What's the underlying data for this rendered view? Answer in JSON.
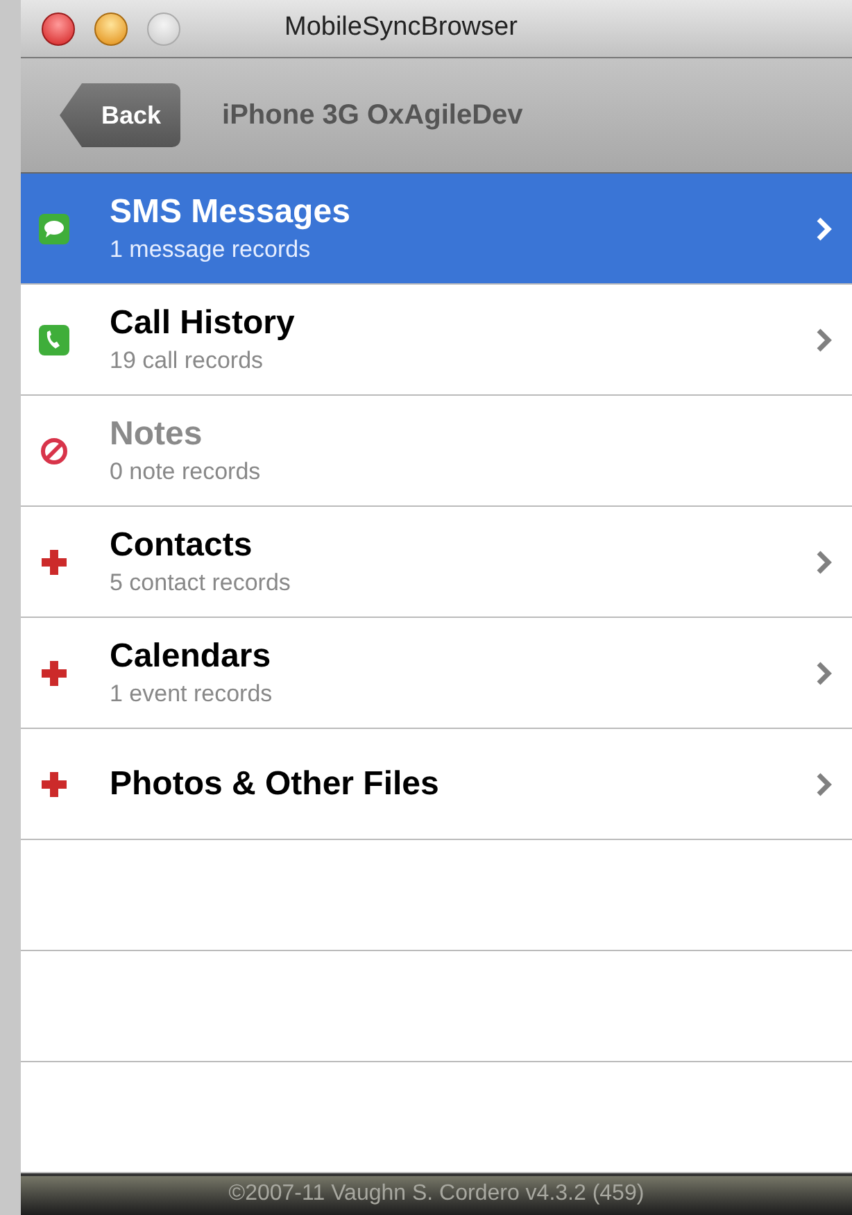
{
  "window": {
    "title": "MobileSyncBrowser"
  },
  "nav_bar": {
    "back_button": "Back",
    "title": "iPhone 3G OxAgileDev"
  },
  "items": [
    {
      "kind": "sms",
      "title": "SMS Messages",
      "subtitle": "1 message records",
      "selected": true,
      "disabled": false
    },
    {
      "kind": "phone",
      "title": "Call History",
      "subtitle": "19 call records",
      "selected": false,
      "disabled": false
    },
    {
      "kind": "blocked",
      "title": "Notes",
      "subtitle": "0 note records",
      "selected": false,
      "disabled": true
    },
    {
      "kind": "add",
      "title": "Contacts",
      "subtitle": "5 contact records",
      "selected": false,
      "disabled": false
    },
    {
      "kind": "add",
      "title": "Calendars",
      "subtitle": "1 event records",
      "selected": false,
      "disabled": false
    },
    {
      "kind": "add",
      "title": "Photos & Other Files",
      "selected": false,
      "disabled": false
    }
  ],
  "footer": "©2007-11 Vaughn S. Cordero v4.3.2 (459)"
}
